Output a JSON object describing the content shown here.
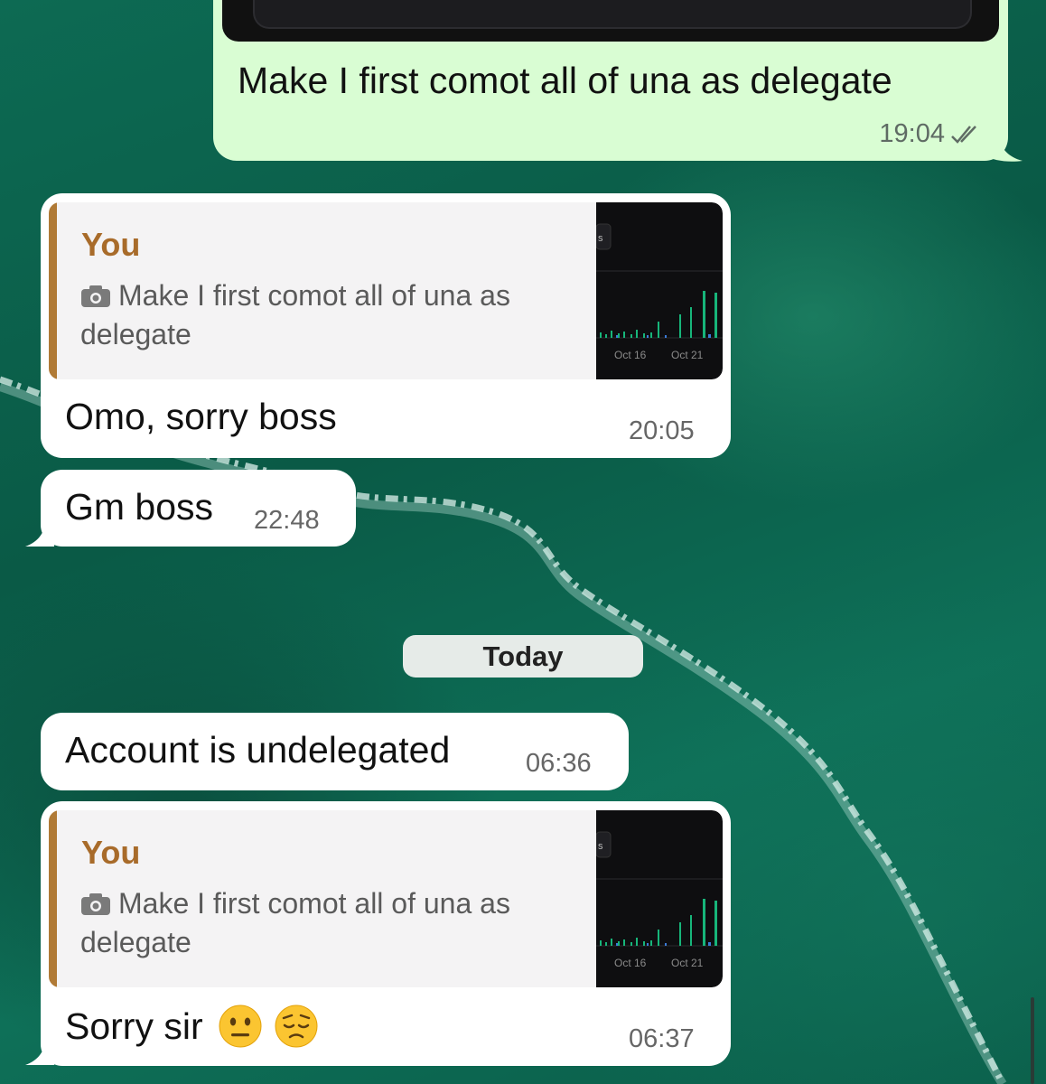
{
  "chat": {
    "outgoing": {
      "text": "Make I first comot all of una as delegate",
      "time": "19:04",
      "status_icon": "double-check-icon"
    },
    "reply1": {
      "quote_author": "You",
      "quote_text": "Make I first comot all of una as delegate",
      "thumb_labels": [
        "Oct 16",
        "Oct 21"
      ],
      "text": "Omo, sorry boss",
      "time": "20:05"
    },
    "msg_gm": {
      "text": "Gm boss",
      "time": "22:48"
    },
    "date_divider": "Today",
    "msg_undelegated": {
      "text": "Account is undelegated",
      "time": "06:36"
    },
    "reply2": {
      "quote_author": "You",
      "quote_text": "Make I first comot all of una as delegate",
      "thumb_labels": [
        "Oct 16",
        "Oct 21"
      ],
      "text": "Sorry sir",
      "emojis": [
        "neutral-face-emoji",
        "pensive-face-emoji"
      ],
      "time": "06:37"
    }
  },
  "colors": {
    "outgoing_bubble": "#d9fdd3",
    "incoming_bubble": "#ffffff",
    "quote_author": "#a86b2a",
    "quote_bar": "#b07a36",
    "wallpaper": "#0b5a47"
  }
}
